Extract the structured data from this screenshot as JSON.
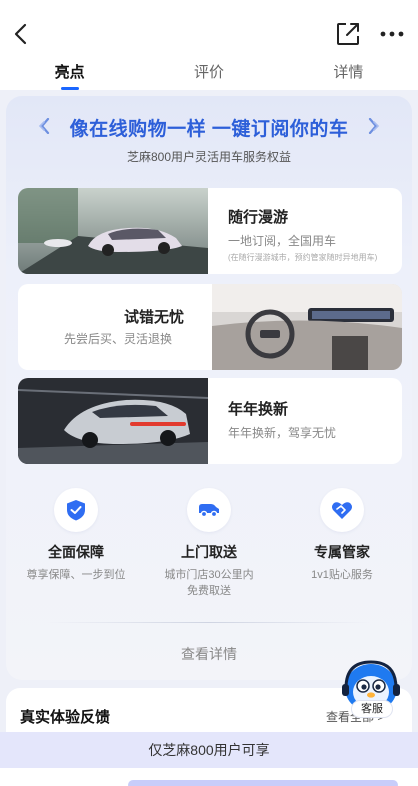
{
  "header": {
    "back_icon": "chevron-left-icon",
    "share_icon": "share-external-icon",
    "more_icon": "more-dots-icon"
  },
  "tabs": [
    {
      "label": "亮点",
      "active": true
    },
    {
      "label": "评价",
      "active": false
    },
    {
      "label": "详情",
      "active": false
    }
  ],
  "highlight": {
    "title": "像在线购物一样 一键订阅你的车",
    "subtitle": "芝麻800用户灵活用车服务权益",
    "features": [
      {
        "title": "随行漫游",
        "desc": "一地订阅，全国用车",
        "note": "(在随行漫游城市，预约管家随时异地用车)"
      },
      {
        "title": "试错无忧",
        "desc": "先尝后买、灵活退换"
      },
      {
        "title": "年年换新",
        "desc": "年年换新，驾享无忧"
      }
    ],
    "services": [
      {
        "icon": "shield-check-icon",
        "title": "全面保障",
        "desc": "尊享保障、一步到位"
      },
      {
        "icon": "delivery-car-icon",
        "title": "上门取送",
        "desc_line1": "城市门店30公里内",
        "desc_line2": "免费取送"
      },
      {
        "icon": "heart-handshake-icon",
        "title": "专属管家",
        "desc": "1v1贴心服务"
      }
    ],
    "detail_link": "查看详情"
  },
  "feedback": {
    "title": "真实体验反馈",
    "all_link": "查看全部 >"
  },
  "customer_service": {
    "label": "客服",
    "icon": "mascot-headset-icon"
  },
  "banner": {
    "text": "仅芝麻800用户可享"
  },
  "colors": {
    "accent": "#1a66ff",
    "headline": "#2d5fd9",
    "banner_bg": "#e4e6fb"
  }
}
